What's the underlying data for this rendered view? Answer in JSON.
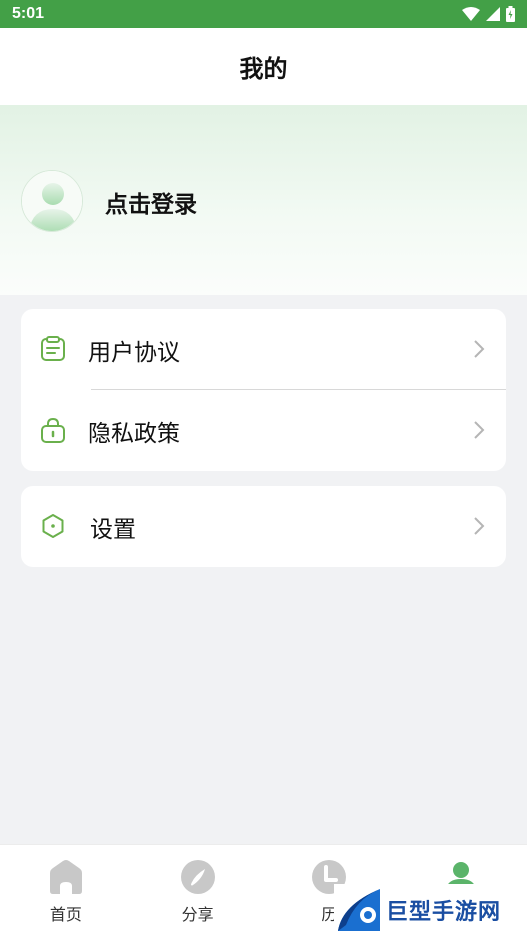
{
  "status_bar": {
    "time": "5:01",
    "color": "#43a047"
  },
  "header": {
    "title": "我的"
  },
  "profile": {
    "login_label": "点击登录",
    "avatar_icon": "user-avatar-icon"
  },
  "menu": {
    "group1": [
      {
        "label": "用户协议",
        "icon": "document-icon"
      },
      {
        "label": "隐私政策",
        "icon": "lock-icon"
      }
    ],
    "group2": [
      {
        "label": "设置",
        "icon": "settings-hexagon-icon"
      }
    ]
  },
  "bottom_nav": [
    {
      "label": "首页",
      "icon": "home-icon",
      "active": false
    },
    {
      "label": "分享",
      "icon": "compass-icon",
      "active": false
    },
    {
      "label": "历",
      "icon": "clock-icon",
      "active": false
    },
    {
      "label": "",
      "icon": "user-icon",
      "active": true
    }
  ],
  "watermark": {
    "text": "巨型手游网"
  },
  "colors": {
    "accent": "#4caf50",
    "icon_green": "#6ab04c",
    "inactive_icon": "#c8c8c8"
  }
}
